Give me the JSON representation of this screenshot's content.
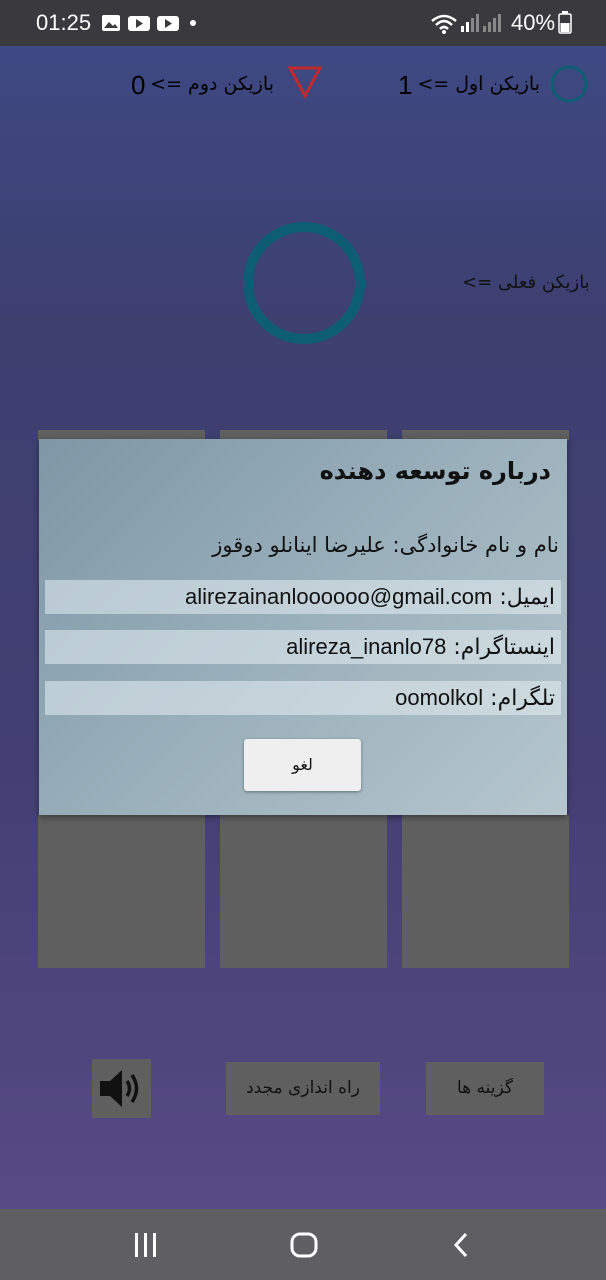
{
  "status_bar": {
    "time": "01:25",
    "battery_percent": "40%",
    "notification_icons": [
      "gallery-icon",
      "youtube-icon",
      "youtube-icon",
      "dot-icon"
    ],
    "system_icons": [
      "wifi-icon",
      "signal-icon",
      "signal-icon",
      "battery-icon"
    ]
  },
  "scores": {
    "player_one_label": "بازیکن اول =>",
    "player_one_value": "1",
    "player_two_label": "بازیکن دوم =>",
    "player_two_value": "0"
  },
  "current_player": {
    "label": "بازیکن فعلی =>",
    "symbol": "circle"
  },
  "dialog": {
    "title": "درباره توسعه دهنده",
    "name_line": "نام و نام خانوادگی: علیرضا اینانلو دوقوز",
    "email_label": "ایمیل:",
    "email_value": "alirezainanloooooo@gmail.com",
    "instagram_label": "اینستاگرام:",
    "instagram_value": "alireza_inanlo78",
    "telegram_label": "تلگرام:",
    "telegram_value": "oomolkol",
    "cancel_label": "لغو"
  },
  "controls": {
    "restart_label": "راه اندازی مجدد",
    "options_label": "گزینه ها",
    "sound_icon": "speaker-icon"
  },
  "colors": {
    "circle": "#0d5e72",
    "triangle": "#c02a2a",
    "cell": "#5f5f5f"
  }
}
